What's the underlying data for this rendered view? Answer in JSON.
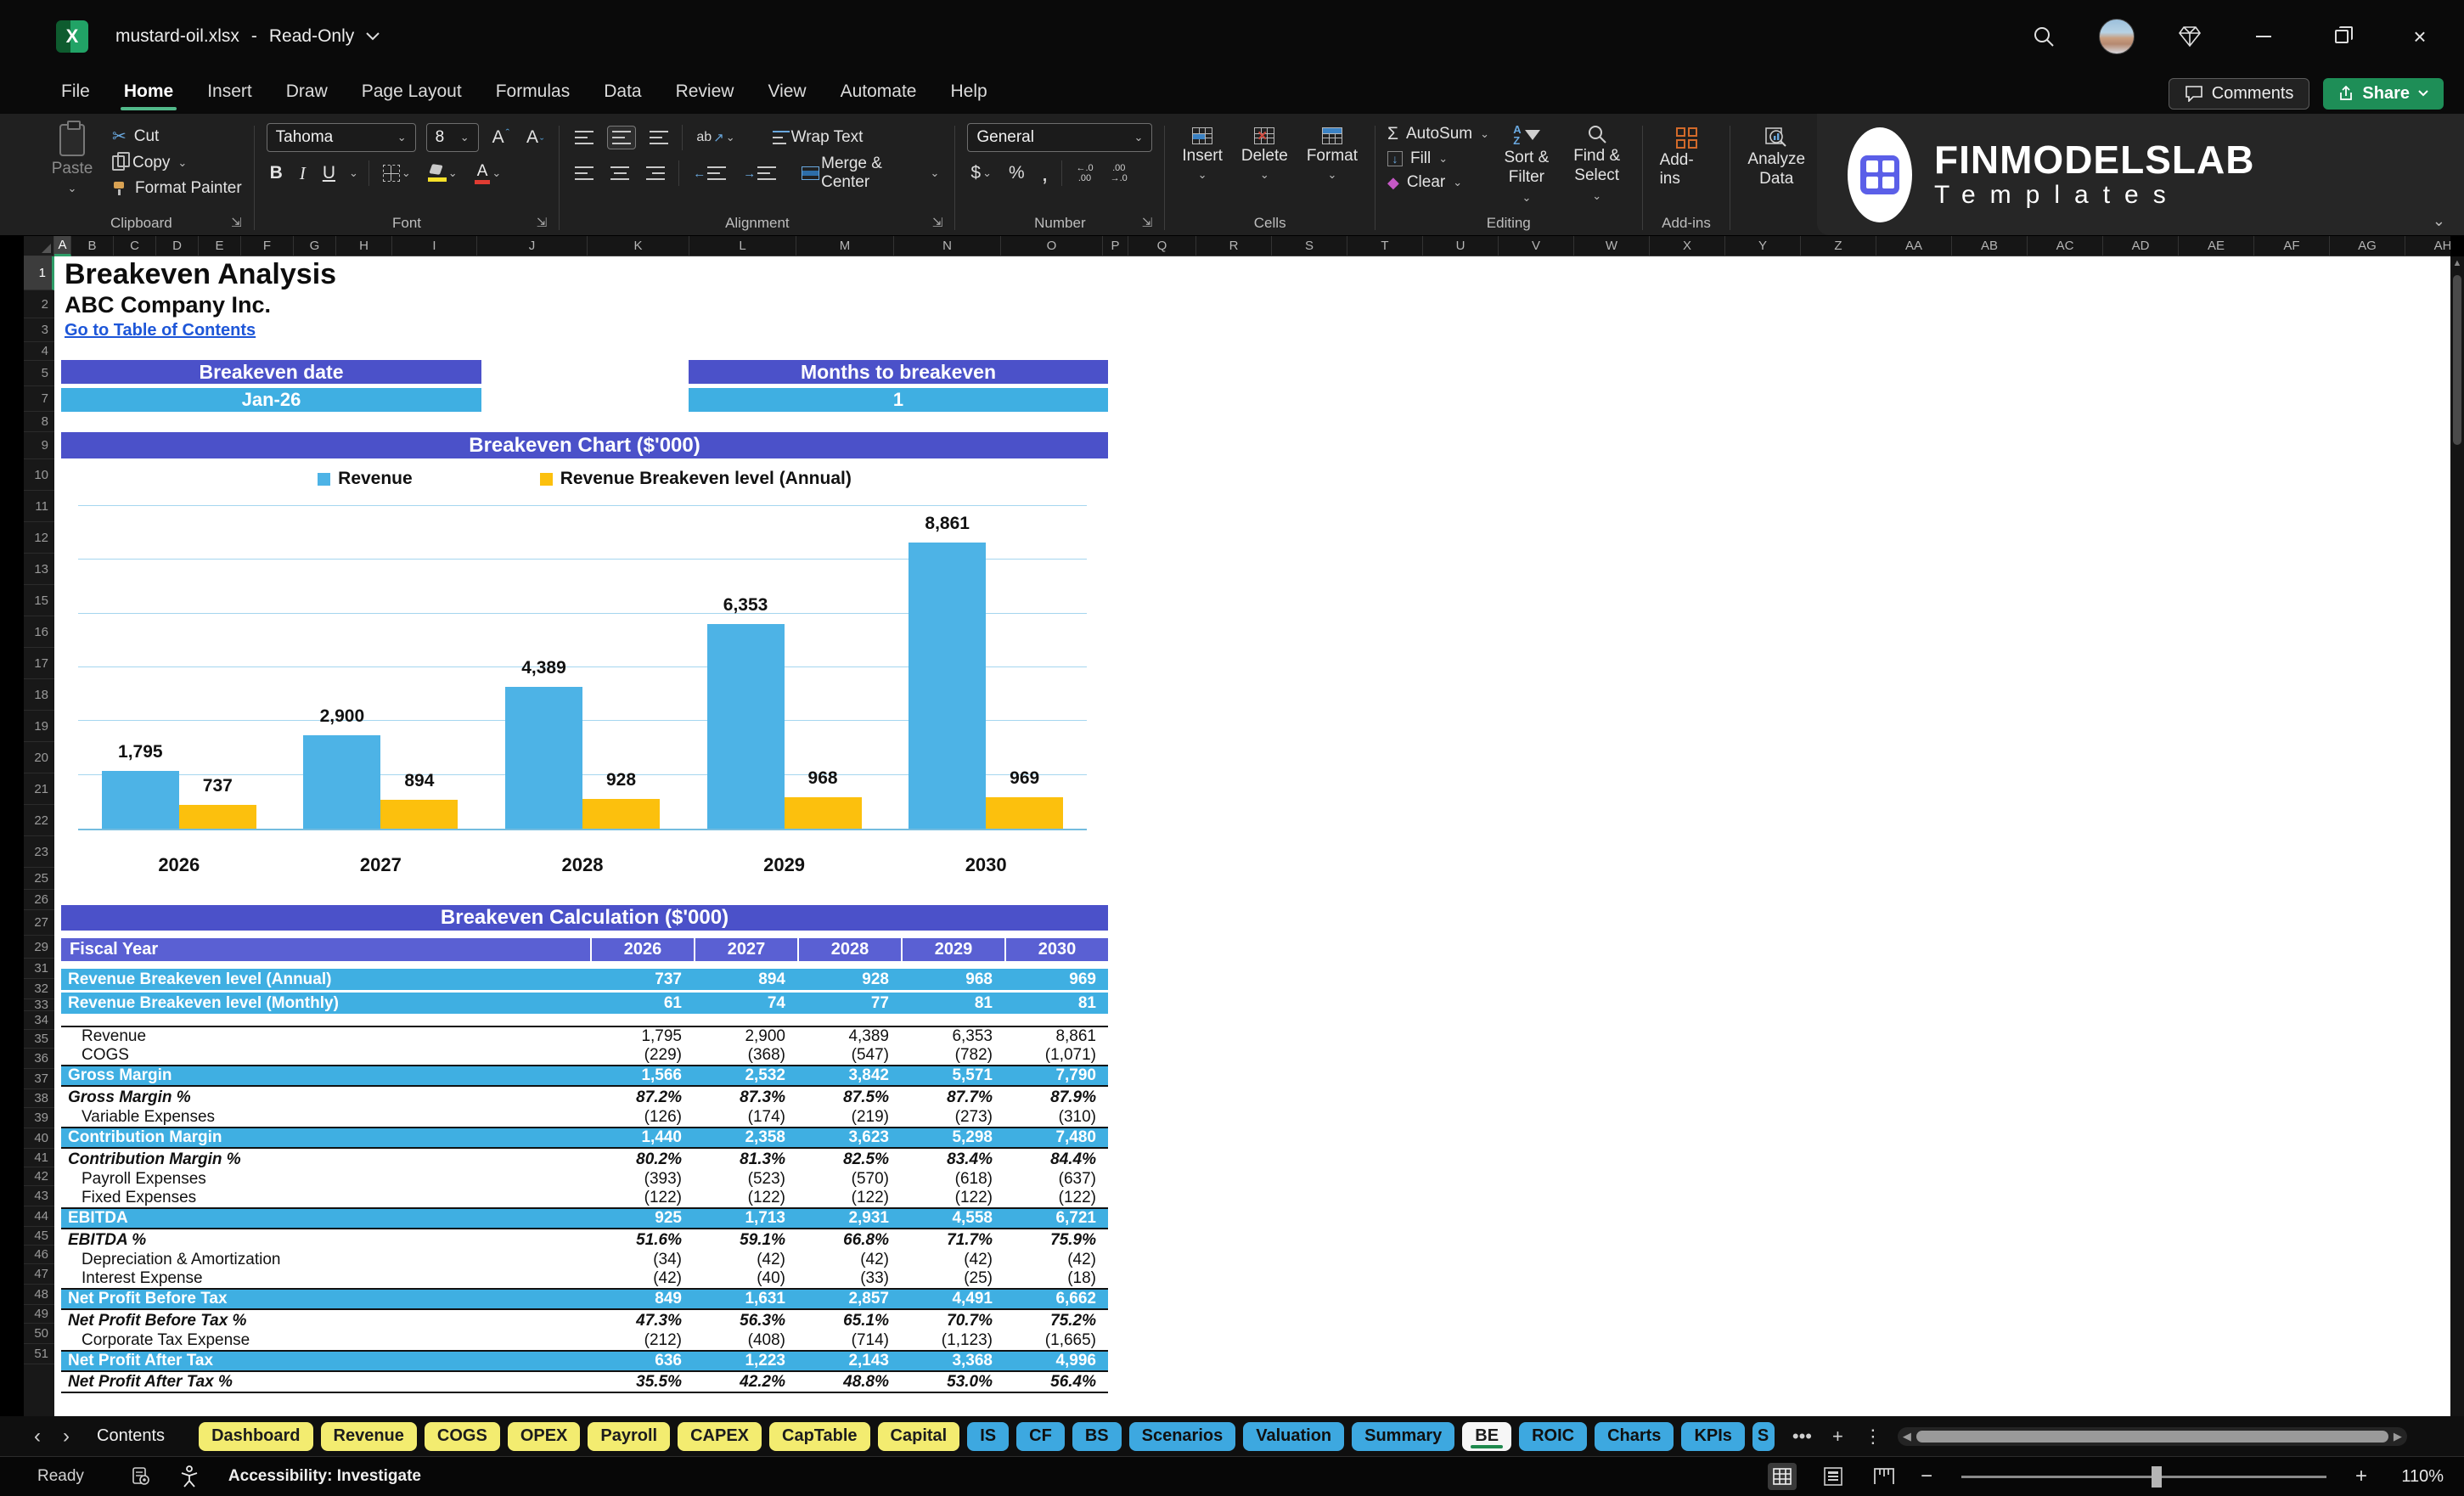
{
  "window": {
    "doc_name": "mustard-oil.xlsx",
    "separator": "-",
    "mode": "Read-Only",
    "app_initial": "X"
  },
  "menu": {
    "items": [
      "File",
      "Home",
      "Insert",
      "Draw",
      "Page Layout",
      "Formulas",
      "Data",
      "Review",
      "View",
      "Automate",
      "Help"
    ],
    "active_index": 1,
    "comments": "Comments",
    "share": "Share"
  },
  "ribbon": {
    "clipboard": {
      "label": "Clipboard",
      "paste": "Paste",
      "cut": "Cut",
      "copy": "Copy",
      "format_painter": "Format Painter"
    },
    "font": {
      "label": "Font",
      "name": "Tahoma",
      "size": "8",
      "bold": "B",
      "italic": "I",
      "underline": "U",
      "grow": "A",
      "shrink": "A"
    },
    "alignment": {
      "label": "Alignment",
      "wrap": "Wrap Text",
      "merge": "Merge & Center",
      "orientation": "ab"
    },
    "number": {
      "label": "Number",
      "format": "General",
      "currency": "$",
      "percent": "%",
      "comma": ",",
      "inc_dec": "←.0\n.00",
      "dec_dec": ".00\n→.0"
    },
    "cells": {
      "label": "Cells",
      "insert": "Insert",
      "delete": "Delete",
      "format": "Format"
    },
    "editing": {
      "label": "Editing",
      "autosum": "AutoSum",
      "fill": "Fill",
      "clear": "Clear",
      "sort_line1": "Sort &",
      "sort_line2": "Filter",
      "find_line1": "Find &",
      "find_line2": "Select"
    },
    "addins": {
      "label": "Add-ins",
      "addins": "Add-ins",
      "analyze_line1": "Analyze",
      "analyze_line2": "Data"
    },
    "logo": {
      "line1": "FINMODELSLAB",
      "line2": "Templates"
    }
  },
  "grid": {
    "columns": [
      "A",
      "B",
      "C",
      "D",
      "E",
      "F",
      "G",
      "H",
      "I",
      "J",
      "K",
      "L",
      "M",
      "N",
      "O",
      "P",
      "Q",
      "R",
      "S",
      "T",
      "U",
      "V",
      "W",
      "X",
      "Y",
      "Z",
      "AA",
      "AB",
      "AC",
      "AD",
      "AE",
      "AF",
      "AG",
      "AH"
    ],
    "selected_column": "A",
    "selected_row": "1",
    "row_numbers": [
      "1",
      "2",
      "3",
      "4",
      "5",
      "7",
      "8",
      "9",
      "10",
      "11",
      "12",
      "13",
      "15",
      "16",
      "17",
      "18",
      "19",
      "20",
      "21",
      "22",
      "23",
      "25",
      "26",
      "27",
      "29",
      "31",
      "32",
      "33",
      "34",
      "35",
      "36",
      "37",
      "38",
      "39",
      "40",
      "41",
      "42",
      "43",
      "44",
      "45",
      "46",
      "47",
      "48",
      "49",
      "50",
      "51"
    ]
  },
  "sheet": {
    "title": "Breakeven Analysis",
    "company": "ABC Company Inc.",
    "toc_link": "Go to Table of Contents",
    "breakeven_date_label": "Breakeven date",
    "breakeven_date_value": "Jan-26",
    "months_label": "Months to breakeven",
    "months_value": "1",
    "chart_header": "Breakeven Chart ($'000)",
    "calc_header": "Breakeven Calculation ($'000)"
  },
  "chart_data": {
    "type": "bar",
    "title": "Breakeven Chart ($'000)",
    "categories": [
      "2026",
      "2027",
      "2028",
      "2029",
      "2030"
    ],
    "series": [
      {
        "name": "Revenue",
        "color": "#4db3e6",
        "values": [
          1795,
          2900,
          4389,
          6353,
          8861
        ],
        "labels": [
          "1,795",
          "2,900",
          "4,389",
          "6,353",
          "8,861"
        ]
      },
      {
        "name": "Revenue Breakeven level (Annual)",
        "color": "#fcc00d",
        "values": [
          737,
          894,
          928,
          968,
          969
        ],
        "labels": [
          "737",
          "894",
          "928",
          "968",
          "969"
        ]
      }
    ],
    "xlabel": "",
    "ylabel": "",
    "ylim": [
      0,
      10000
    ],
    "gridline_count": 6,
    "grid": true,
    "legend_position": "top"
  },
  "table": {
    "fiscal_year_label": "Fiscal Year",
    "years": [
      "2026",
      "2027",
      "2028",
      "2029",
      "2030"
    ],
    "rows": [
      {
        "label": "Revenue Breakeven level (Annual)",
        "values": [
          "737",
          "894",
          "928",
          "968",
          "969"
        ],
        "style": "highlight"
      },
      {
        "label": "Revenue Breakeven level (Monthly)",
        "values": [
          "61",
          "74",
          "77",
          "81",
          "81"
        ],
        "style": "highlight"
      },
      {
        "label": "",
        "values": [
          "",
          "",
          "",
          "",
          ""
        ],
        "style": "spacer"
      },
      {
        "label": "Revenue",
        "values": [
          "1,795",
          "2,900",
          "4,389",
          "6,353",
          "8,861"
        ],
        "style": "plain"
      },
      {
        "label": "COGS",
        "values": [
          "(229)",
          "(368)",
          "(547)",
          "(782)",
          "(1,071)"
        ],
        "style": "plain"
      },
      {
        "label": "Gross Margin",
        "values": [
          "1,566",
          "2,532",
          "3,842",
          "5,571",
          "7,790"
        ],
        "style": "total"
      },
      {
        "label": "Gross Margin %",
        "values": [
          "87.2%",
          "87.3%",
          "87.5%",
          "87.7%",
          "87.9%"
        ],
        "style": "percent"
      },
      {
        "label": "Variable Expenses",
        "values": [
          "(126)",
          "(174)",
          "(219)",
          "(273)",
          "(310)"
        ],
        "style": "plain"
      },
      {
        "label": "Contribution Margin",
        "values": [
          "1,440",
          "2,358",
          "3,623",
          "5,298",
          "7,480"
        ],
        "style": "total"
      },
      {
        "label": "Contribution Margin %",
        "values": [
          "80.2%",
          "81.3%",
          "82.5%",
          "83.4%",
          "84.4%"
        ],
        "style": "percent"
      },
      {
        "label": "Payroll Expenses",
        "values": [
          "(393)",
          "(523)",
          "(570)",
          "(618)",
          "(637)"
        ],
        "style": "plain"
      },
      {
        "label": "Fixed Expenses",
        "values": [
          "(122)",
          "(122)",
          "(122)",
          "(122)",
          "(122)"
        ],
        "style": "plain"
      },
      {
        "label": "EBITDA",
        "values": [
          "925",
          "1,713",
          "2,931",
          "4,558",
          "6,721"
        ],
        "style": "total"
      },
      {
        "label": "EBITDA %",
        "values": [
          "51.6%",
          "59.1%",
          "66.8%",
          "71.7%",
          "75.9%"
        ],
        "style": "percent"
      },
      {
        "label": "Depreciation & Amortization",
        "values": [
          "(34)",
          "(42)",
          "(42)",
          "(42)",
          "(42)"
        ],
        "style": "plain"
      },
      {
        "label": "Interest Expense",
        "values": [
          "(42)",
          "(40)",
          "(33)",
          "(25)",
          "(18)"
        ],
        "style": "plain"
      },
      {
        "label": "Net Profit Before Tax",
        "values": [
          "849",
          "1,631",
          "2,857",
          "4,491",
          "6,662"
        ],
        "style": "total"
      },
      {
        "label": "Net Profit Before Tax %",
        "values": [
          "47.3%",
          "56.3%",
          "65.1%",
          "70.7%",
          "75.2%"
        ],
        "style": "percent"
      },
      {
        "label": "Corporate Tax Expense",
        "values": [
          "(212)",
          "(408)",
          "(714)",
          "(1,123)",
          "(1,665)"
        ],
        "style": "plain"
      },
      {
        "label": "Net Profit After Tax",
        "values": [
          "636",
          "1,223",
          "2,143",
          "3,368",
          "4,996"
        ],
        "style": "total"
      },
      {
        "label": "Net Profit After Tax %",
        "values": [
          "35.5%",
          "42.2%",
          "48.8%",
          "53.0%",
          "56.4%"
        ],
        "style": "percent"
      }
    ]
  },
  "tabs": {
    "items": [
      {
        "label": "Contents",
        "type": "plain"
      },
      {
        "label": "Dashboard",
        "type": "yellow"
      },
      {
        "label": "Revenue",
        "type": "yellow"
      },
      {
        "label": "COGS",
        "type": "yellow"
      },
      {
        "label": "OPEX",
        "type": "yellow"
      },
      {
        "label": "Payroll",
        "type": "yellow"
      },
      {
        "label": "CAPEX",
        "type": "yellow"
      },
      {
        "label": "CapTable",
        "type": "yellow"
      },
      {
        "label": "Capital",
        "type": "yellow"
      },
      {
        "label": "IS",
        "type": "blue"
      },
      {
        "label": "CF",
        "type": "blue"
      },
      {
        "label": "BS",
        "type": "blue"
      },
      {
        "label": "Scenarios",
        "type": "blue"
      },
      {
        "label": "Valuation",
        "type": "blue"
      },
      {
        "label": "Summary",
        "type": "blue"
      },
      {
        "label": "BE",
        "type": "active"
      },
      {
        "label": "ROIC",
        "type": "blue"
      },
      {
        "label": "Charts",
        "type": "blue"
      },
      {
        "label": "KPIs",
        "type": "blue"
      },
      {
        "label": "S",
        "type": "blue-cut"
      }
    ]
  },
  "status": {
    "ready": "Ready",
    "accessibility": "Accessibility: Investigate",
    "zoom": "110%"
  },
  "colors": {
    "header_purple": "#4b51c9",
    "fiscal_purple": "#5a60d3",
    "row_blue": "#3fafe2",
    "bar_blue": "#4db3e6",
    "bar_yellow": "#fcc00d",
    "tab_yellow": "#f3ec70",
    "tab_blue": "#3da8e0",
    "link_blue": "#1d56d8",
    "share_green": "#1e8e57",
    "active_tab_green": "#1f8a4d",
    "gridline_blue": "#a5d6ef"
  }
}
